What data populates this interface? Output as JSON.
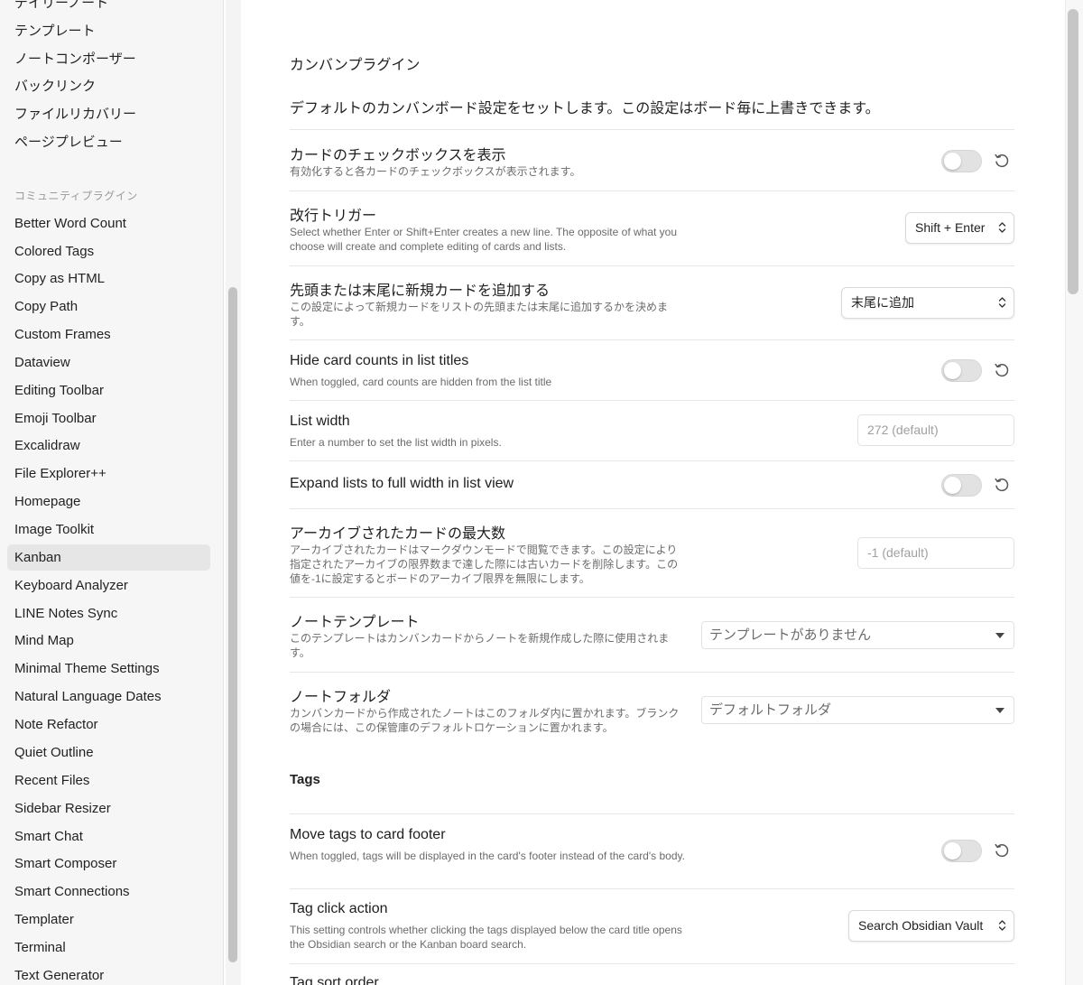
{
  "sidebar": {
    "items_top": [
      {
        "label": "デイリーノート"
      },
      {
        "label": "テンプレート"
      },
      {
        "label": "ノートコンポーザー"
      },
      {
        "label": "バックリンク"
      },
      {
        "label": "ファイルリカバリー"
      },
      {
        "label": "ページプレビュー"
      }
    ],
    "community_section": "コミュニティプラグイン",
    "items": [
      {
        "label": "Better Word Count"
      },
      {
        "label": "Colored Tags"
      },
      {
        "label": "Copy as HTML"
      },
      {
        "label": "Copy Path"
      },
      {
        "label": "Custom Frames"
      },
      {
        "label": "Dataview"
      },
      {
        "label": "Editing Toolbar"
      },
      {
        "label": "Emoji Toolbar"
      },
      {
        "label": "Excalidraw"
      },
      {
        "label": "File Explorer++"
      },
      {
        "label": "Homepage"
      },
      {
        "label": "Image Toolkit"
      },
      {
        "label": "Kanban",
        "active": true
      },
      {
        "label": "Keyboard Analyzer"
      },
      {
        "label": "LINE Notes Sync"
      },
      {
        "label": "Mind Map"
      },
      {
        "label": "Minimal Theme Settings"
      },
      {
        "label": "Natural Language Dates"
      },
      {
        "label": "Note Refactor"
      },
      {
        "label": "Quiet Outline"
      },
      {
        "label": "Recent Files"
      },
      {
        "label": "Sidebar Resizer"
      },
      {
        "label": "Smart Chat"
      },
      {
        "label": "Smart Composer"
      },
      {
        "label": "Smart Connections"
      },
      {
        "label": "Templater"
      },
      {
        "label": "Terminal"
      },
      {
        "label": "Text Generator"
      }
    ]
  },
  "main": {
    "plugin_title": "カンバンプラグイン",
    "plugin_desc": "デフォルトのカンバンボード設定をセットします。この設定はボード毎に上書きできます。",
    "settings": {
      "checkbox": {
        "name": "カードのチェックボックスを表示",
        "desc": "有効化すると各カードのチェックボックスが表示されます。",
        "enabled": false
      },
      "newline": {
        "name": "改行トリガー",
        "desc": "Select whether Enter or Shift+Enter creates a new line. The opposite of what you choose will create and complete editing of cards and lists.",
        "value": "Shift + Enter"
      },
      "new_card": {
        "name": "先頭または末尾に新規カードを追加する",
        "desc": "この設定によって新規カードをリストの先頭または末尾に追加するかを決めます。",
        "value": "末尾に追加"
      },
      "hide_counts": {
        "name": "Hide card counts in list titles",
        "desc": "When toggled, card counts are hidden from the list title",
        "enabled": false
      },
      "list_width": {
        "name": "List width",
        "desc": "Enter a number to set the list width in pixels.",
        "placeholder": "272 (default)"
      },
      "expand_lists": {
        "name": "Expand lists to full width in list view",
        "enabled": false
      },
      "max_archive": {
        "name": "アーカイブされたカードの最大数",
        "desc": "アーカイブされたカードはマークダウンモードで閲覧できます。この設定により指定されたアーカイブの限界数まで達した際には古いカードを削除します。この値を-1に設定するとボードのアーカイブ限界を無限にします。",
        "placeholder": "-1 (default)"
      },
      "note_template": {
        "name": "ノートテンプレート",
        "desc": "このテンプレートはカンバンカードからノートを新規作成した際に使用されます。",
        "value": "テンプレートがありません"
      },
      "note_folder": {
        "name": "ノートフォルダ",
        "desc": "カンバンカードから作成されたノートはこのフォルダ内に置かれます。ブランクの場合には、この保管庫のデフォルトロケーションに置かれます。",
        "value": "デフォルトフォルダ"
      }
    },
    "tags_heading": "Tags",
    "tags": {
      "move_tags": {
        "name": "Move tags to card footer",
        "desc": "When toggled, tags will be displayed in the card's footer instead of the card's body.",
        "enabled": false
      },
      "tag_click": {
        "name": "Tag click action",
        "desc": "This setting controls whether clicking the tags displayed below the card title opens the Obsidian search or the Kanban board search.",
        "value": "Search Obsidian Vault"
      },
      "tag_sort": {
        "name": "Tag sort order"
      }
    }
  }
}
